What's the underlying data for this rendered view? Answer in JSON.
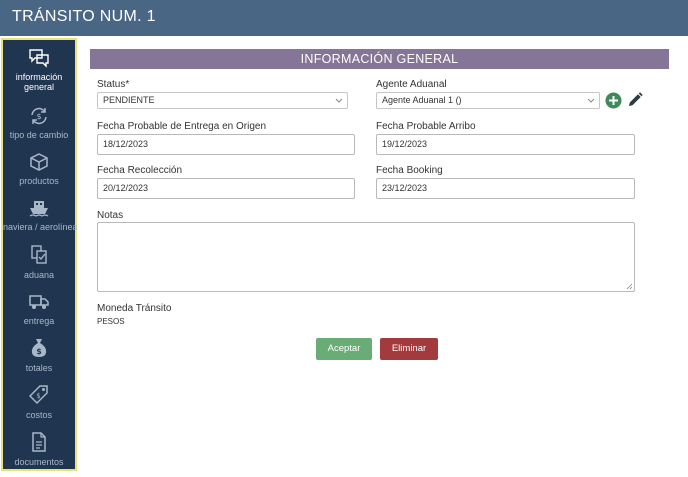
{
  "header": {
    "title": "TRÁNSITO NUM. 1"
  },
  "sidebar": {
    "items": [
      {
        "label_line1": "información",
        "label_line2": "general",
        "icon": "chat-bubble-icon",
        "active": true
      },
      {
        "label": "tipo de cambio",
        "icon": "currency-exchange-icon"
      },
      {
        "label": "productos",
        "icon": "box-icon"
      },
      {
        "label": "naviera / aerolínea",
        "icon": "ship-icon"
      },
      {
        "label": "aduana",
        "icon": "customs-documents-icon"
      },
      {
        "label": "entrega",
        "icon": "truck-icon"
      },
      {
        "label": "totales",
        "icon": "money-bag-icon"
      },
      {
        "label": "costos",
        "icon": "price-tag-icon"
      },
      {
        "label": "documentos",
        "icon": "document-icon"
      }
    ]
  },
  "main": {
    "section_title": "INFORMACIÓN GENERAL",
    "fields": {
      "status": {
        "label": "Status*",
        "value": "PENDIENTE"
      },
      "agente": {
        "label": "Agente Aduanal",
        "value": "Agente Aduanal 1 ()"
      },
      "fecha_entrega": {
        "label": "Fecha Probable de Entrega en Origen",
        "value": "18/12/2023"
      },
      "fecha_arribo": {
        "label": "Fecha Probable Arribo",
        "value": "19/12/2023"
      },
      "fecha_recoleccion": {
        "label": "Fecha Recolección",
        "value": "20/12/2023"
      },
      "fecha_booking": {
        "label": "Fecha Booking",
        "value": "23/12/2023"
      },
      "notas": {
        "label": "Notas",
        "value": ""
      },
      "moneda": {
        "label": "Moneda Tránsito",
        "value": "PESOS"
      }
    },
    "buttons": {
      "accept": "Aceptar",
      "delete": "Eliminar"
    }
  },
  "colors": {
    "topbar": "#4a6685",
    "sidebar": "#1f3550",
    "sidebar_border": "#e8e27a",
    "section_header": "#857596",
    "accept": "#6aac75",
    "delete": "#a23a3e",
    "add_icon": "#3f8a5a"
  }
}
